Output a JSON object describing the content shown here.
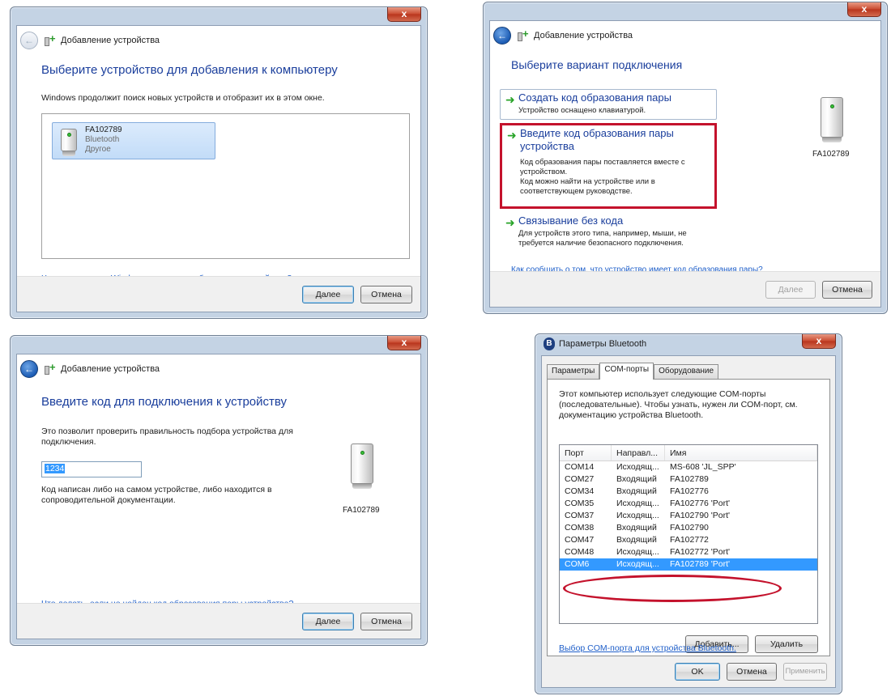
{
  "window1": {
    "title": "Добавление устройства",
    "heading": "Выберите устройство для добавления к компьютеру",
    "description": "Windows продолжит поиск новых устройств и отобразит их в этом окне.",
    "device": {
      "name": "FA102789",
      "type": "Bluetooth",
      "category": "Другое"
    },
    "help_link": "Что делать, если Windows не удалось обнаружить устройство?",
    "next_label": "Далее",
    "cancel_label": "Отмена",
    "close_label": "x"
  },
  "window2": {
    "title": "Добавление устройства",
    "heading": "Выберите вариант подключения",
    "options": [
      {
        "title": "Создать код образования пары",
        "desc": [
          "Устройство оснащено клавиатурой."
        ]
      },
      {
        "title": "Введите код образования пары устройства",
        "desc": [
          "Код образования пары поставляется вместе с",
          "устройством.",
          "Код можно найти на устройстве или в",
          "соответствующем руководстве."
        ]
      },
      {
        "title": "Связывание без кода",
        "desc": [
          "Для устройств этого типа, например, мыши, не",
          "требуется наличие безопасного подключения."
        ]
      }
    ],
    "device_name": "FA102789",
    "help_link": "Как сообщить о том, что устройство имеет код образования пары?",
    "next_label": "Далее",
    "cancel_label": "Отмена",
    "close_label": "x"
  },
  "window3": {
    "title": "Добавление устройства",
    "heading": "Введите код для подключения к устройству",
    "description_1": "Это позволит проверить правильность подбора устройства для",
    "description_2": "подключения.",
    "pin_value": "1234",
    "hint_1": "Код написан либо на самом устройстве, либо находится в",
    "hint_2": "сопроводительной документации.",
    "device_name": "FA102789",
    "help_link": "Что делать, если не найден код образования пары устройства?",
    "next_label": "Далее",
    "cancel_label": "Отмена",
    "close_label": "x"
  },
  "window4": {
    "title": "Параметры Bluetooth",
    "tabs": [
      "Параметры",
      "COM-порты",
      "Оборудование"
    ],
    "active_tab": 1,
    "description_1": "Этот компьютер использует следующие COM-порты",
    "description_2": "(последовательные). Чтобы узнать, нужен ли COM-порт, см.",
    "description_3": "документацию устройства Bluetooth.",
    "columns": [
      "Порт",
      "Направл...",
      "Имя"
    ],
    "rows": [
      [
        "COM14",
        "Исходящ...",
        "MS-608 'JL_SPP'"
      ],
      [
        "COM27",
        "Входящий",
        "FA102789"
      ],
      [
        "COM34",
        "Входящий",
        "FA102776"
      ],
      [
        "COM35",
        "Исходящ...",
        "FA102776 'Port'"
      ],
      [
        "COM37",
        "Исходящ...",
        "FA102790 'Port'"
      ],
      [
        "COM38",
        "Входящий",
        "FA102790"
      ],
      [
        "COM47",
        "Входящий",
        "FA102772"
      ],
      [
        "COM48",
        "Исходящ...",
        "FA102772 'Port'"
      ],
      [
        "COM6",
        "Исходящ...",
        "FA102789 'Port'"
      ]
    ],
    "selected_row": 8,
    "add_label": "Добавить...",
    "remove_label": "Удалить",
    "link": "Выбор COM-порта для устройства Bluetooth.",
    "ok_label": "OK",
    "cancel_label": "Отмена",
    "apply_label": "Применить",
    "close_label": "x"
  }
}
